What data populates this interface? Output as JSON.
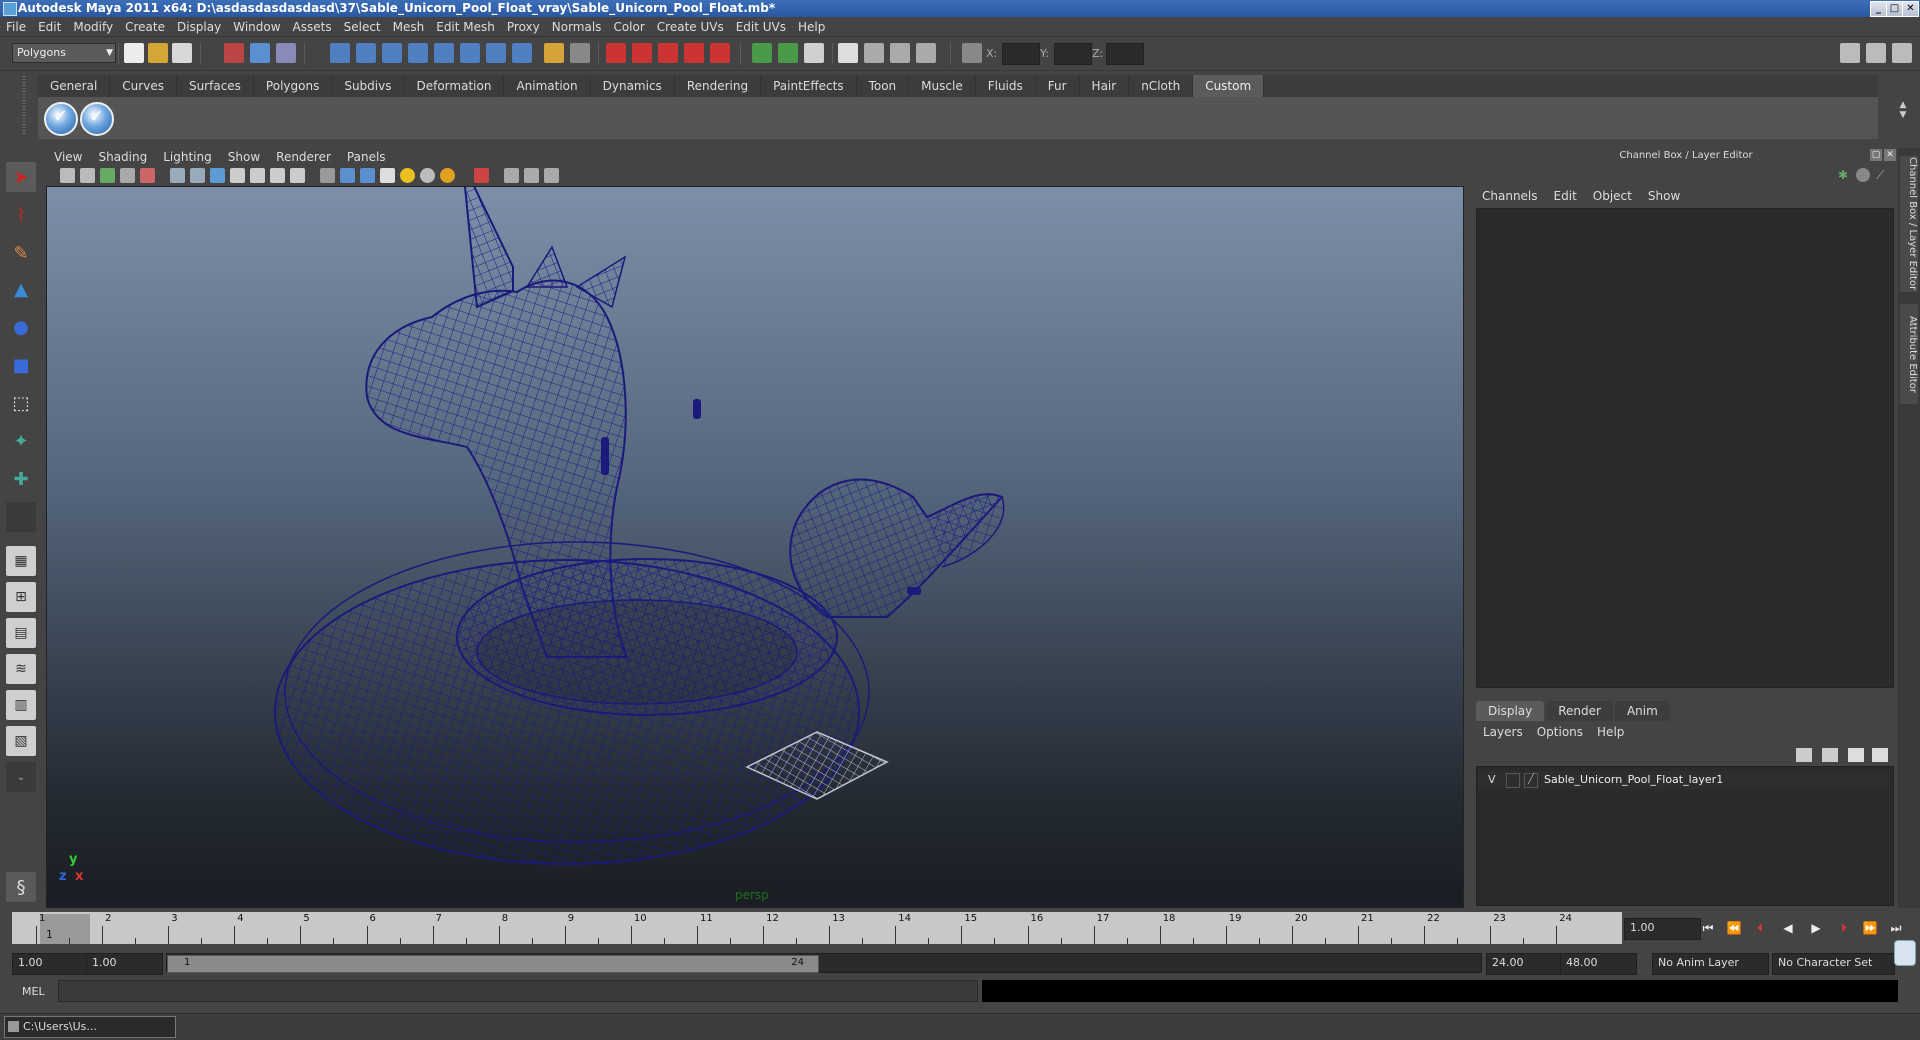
{
  "window": {
    "title": "Autodesk Maya 2011 x64: D:\\asdasdasdasdasd\\37\\Sable_Unicorn_Pool_Float_vray\\Sable_Unicorn_Pool_Float.mb*"
  },
  "menubar": [
    "File",
    "Edit",
    "Modify",
    "Create",
    "Display",
    "Window",
    "Assets",
    "Select",
    "Mesh",
    "Edit Mesh",
    "Proxy",
    "Normals",
    "Color",
    "Create UVs",
    "Edit UVs",
    "Help"
  ],
  "statusline": {
    "menuset": "Polygons",
    "x_label": "X:",
    "y_label": "Y:",
    "z_label": "Z:"
  },
  "shelf": {
    "tabs": [
      "General",
      "Curves",
      "Surfaces",
      "Polygons",
      "Subdivs",
      "Deformation",
      "Animation",
      "Dynamics",
      "Rendering",
      "PaintEffects",
      "Toon",
      "Muscle",
      "Fluids",
      "Fur",
      "Hair",
      "nCloth",
      "Custom"
    ],
    "active_tab": "Custom"
  },
  "viewport": {
    "menu": [
      "View",
      "Shading",
      "Lighting",
      "Show",
      "Renderer",
      "Panels"
    ],
    "camera": "persp",
    "axis_y": "y",
    "axis_x": "x",
    "axis_z": "z"
  },
  "channel_box": {
    "header": "Channel Box / Layer Editor",
    "menu": [
      "Channels",
      "Edit",
      "Object",
      "Show"
    ]
  },
  "layer_editor": {
    "tabs": [
      "Display",
      "Render",
      "Anim"
    ],
    "active_tab": "Display",
    "menu": [
      "Layers",
      "Options",
      "Help"
    ],
    "layers": [
      {
        "visible": "V",
        "name": "Sable_Unicorn_Pool_Float_layer1"
      }
    ]
  },
  "side_tabs": [
    "Channel Box / Layer Editor",
    "Attribute Editor"
  ],
  "timeline": {
    "ticks": [
      "1",
      "2",
      "3",
      "4",
      "5",
      "6",
      "7",
      "8",
      "9",
      "10",
      "11",
      "12",
      "13",
      "14",
      "15",
      "16",
      "17",
      "18",
      "19",
      "20",
      "21",
      "22",
      "23",
      "24"
    ],
    "current_frame": "1",
    "current_time_field": "1.00"
  },
  "range": {
    "start_time": "1.00",
    "playback_start": "1.00",
    "range_start_label": "1",
    "range_end_label": "24",
    "playback_end": "24.00",
    "end_time": "48.00",
    "anim_layer": "No Anim Layer",
    "character_set": "No Character Set"
  },
  "command_line": {
    "label": "MEL"
  },
  "taskbar": {
    "item": "C:\\Users\\Us..."
  },
  "colors": {
    "wire": "#1a1a7a",
    "viewport_top": "#7d8fa8",
    "viewport_bottom": "#1a1d22",
    "active_tab": "#5b5b5b"
  }
}
